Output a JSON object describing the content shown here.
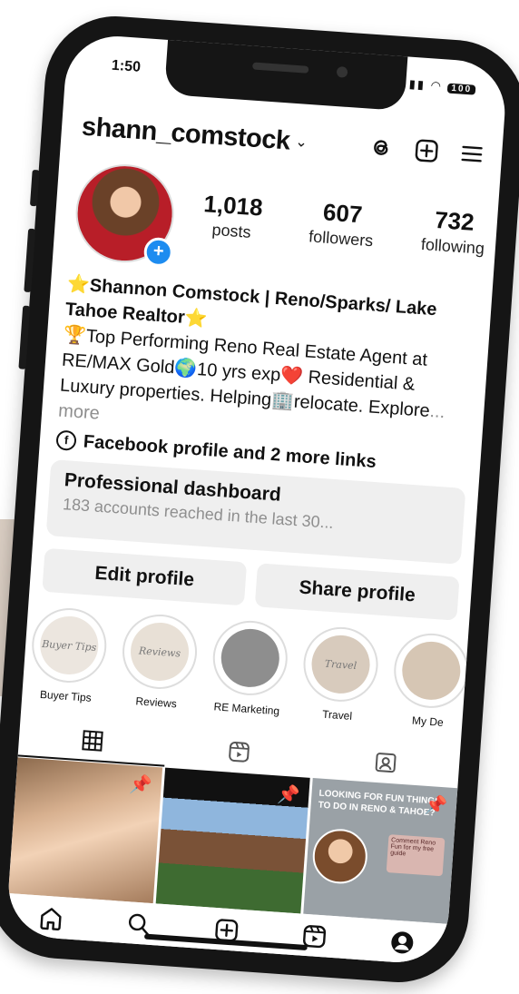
{
  "status": {
    "time": "1:50",
    "battery": "100"
  },
  "header": {
    "username": "shann_comstock"
  },
  "stats": [
    {
      "value": "1,018",
      "label": "posts"
    },
    {
      "value": "607",
      "label": "followers"
    },
    {
      "value": "732",
      "label": "following"
    }
  ],
  "bio": {
    "name": "⭐Shannon Comstock | Reno/Sparks/ Lake Tahoe Realtor⭐",
    "line1": "🏆Top Performing Reno Real Estate Agent at RE/MAX Gold🌍10 yrs exp❤️ Residential & Luxury properties. Helping🏢relocate. Explore",
    "more": "... more",
    "links": "Facebook profile and 2 more links"
  },
  "dashboard": {
    "title": "Professional dashboard",
    "subtitle": "183 accounts reached in the last 30..."
  },
  "buttons": {
    "edit": "Edit profile",
    "share": "Share profile"
  },
  "highlights": [
    {
      "label": "Buyer Tips",
      "cover": "Buyer Tips",
      "bg": "#ece6df"
    },
    {
      "label": "Reviews",
      "cover": "Reviews",
      "bg": "#e8e0d6"
    },
    {
      "label": "RE Marketing",
      "cover": "",
      "bg": "#8e8e8e"
    },
    {
      "label": "Travel",
      "cover": "Travel",
      "bg": "#d8cbbd"
    },
    {
      "label": "My De",
      "cover": "",
      "bg": "#d6c6b4"
    }
  ],
  "grid": {
    "post3_text": "LOOKING FOR FUN THINGS TO DO IN RENO & TAHOE?",
    "post3_box": "Comment Reno Fun for my free guide"
  },
  "colors": {
    "accent": "#1d8cf0",
    "button_bg": "#efefef",
    "muted": "#8e8e8e"
  }
}
